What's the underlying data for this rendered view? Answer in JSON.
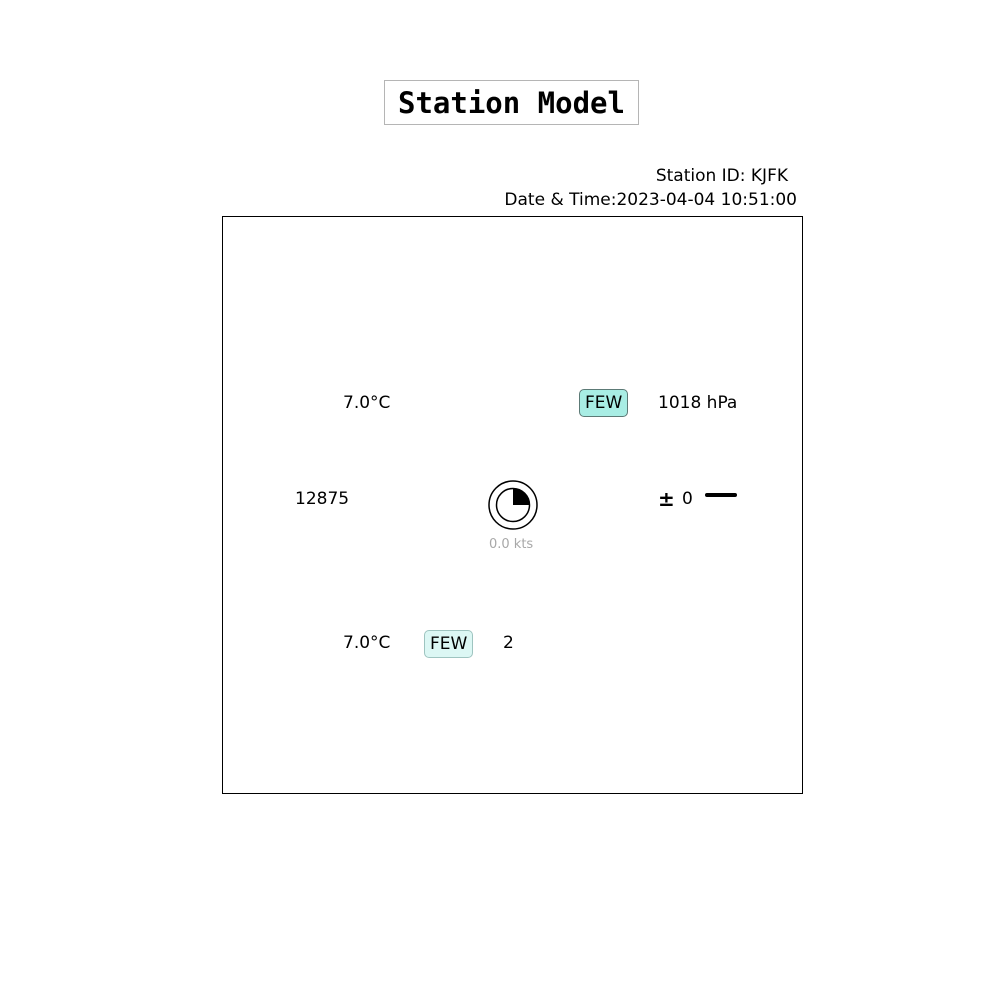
{
  "title": "Station Model",
  "station_id_label": "Station ID: KJFK",
  "datetime_label": "Date & Time:2023-04-04 10:51:00",
  "temperature": "7.0°C",
  "dewpoint": "7.0°C",
  "visibility": "12875",
  "pressure": "1018 hPa",
  "pressure_tendency_symbol": "±",
  "pressure_tendency_value": "0",
  "upper_cloud_type": "FEW",
  "lower_cloud_type": "FEW",
  "lower_cloud_value": "2",
  "wind_speed": "0.0 kts",
  "sky_cover_fraction": 0.25,
  "colors": {
    "upper_cloud_bg": "#a8ede4",
    "lower_cloud_bg": "#dcf7f4",
    "wind_text": "#a8a8a8"
  }
}
